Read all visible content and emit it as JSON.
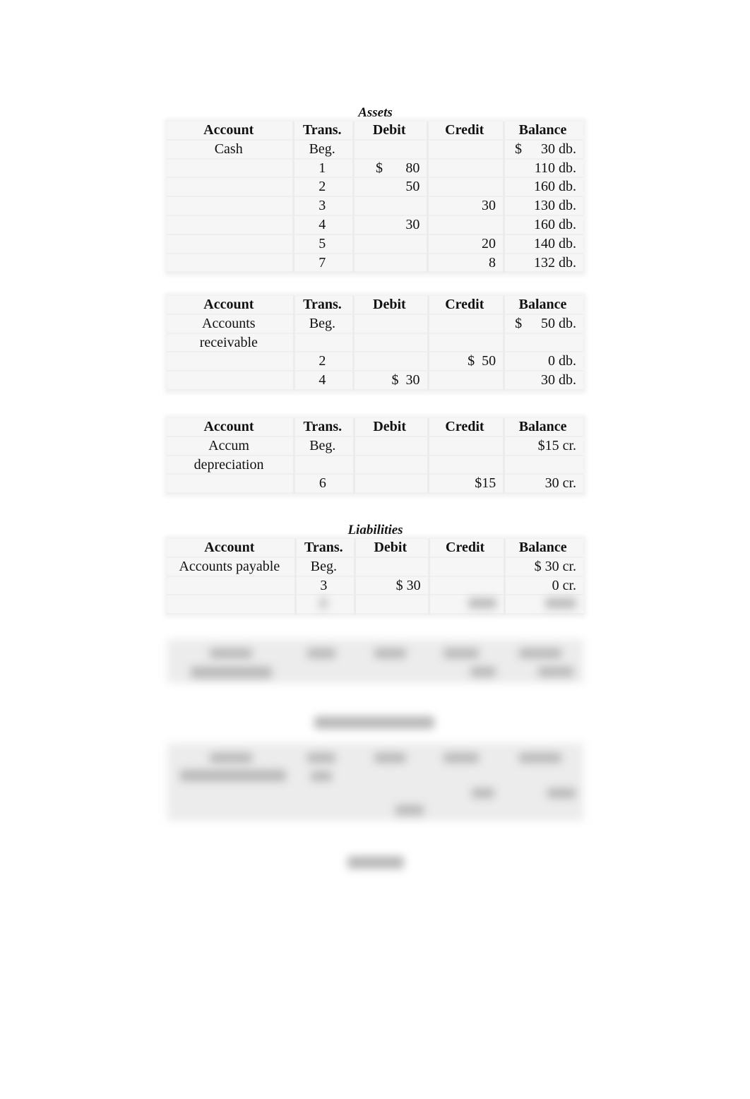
{
  "columns": [
    "Account",
    "Trans.",
    "Debit",
    "Credit",
    "Balance"
  ],
  "sections": {
    "assets": "Assets",
    "liabilities": "Liabilities"
  },
  "ledgers": {
    "cash": {
      "account": "Cash",
      "rows": [
        {
          "trans": "Beg.",
          "debit": "",
          "credit": "",
          "balance_sign": "$",
          "balance": "30 db."
        },
        {
          "trans": "1",
          "debit_sign": "$",
          "debit": "80",
          "credit": "",
          "balance": "110 db."
        },
        {
          "trans": "2",
          "debit": "50",
          "credit": "",
          "balance": "160 db."
        },
        {
          "trans": "3",
          "debit": "",
          "credit": "30",
          "balance": "130 db."
        },
        {
          "trans": "4",
          "debit": "30",
          "credit": "",
          "balance": "160 db."
        },
        {
          "trans": "5",
          "debit": "",
          "credit": "20",
          "balance": "140 db."
        },
        {
          "trans": "7",
          "debit": "",
          "credit": "8",
          "balance": "132 db."
        }
      ]
    },
    "accounts_receivable": {
      "account_line1": "Accounts",
      "account_line2": "receivable",
      "rows": [
        {
          "trans": "Beg.",
          "debit": "",
          "credit": "",
          "balance_sign": "$",
          "balance": "50 db."
        },
        {
          "trans": "2",
          "debit": "",
          "credit": "$  50",
          "balance": "0 db."
        },
        {
          "trans": "4",
          "debit": "$  30",
          "credit": "",
          "balance": "30 db."
        }
      ]
    },
    "accum_depreciation": {
      "account_line1": "Accum",
      "account_line2": "depreciation",
      "rows": [
        {
          "trans": "Beg.",
          "debit": "",
          "credit": "",
          "balance": "$15 cr."
        },
        {
          "trans": "6",
          "debit": "",
          "credit": "$15",
          "balance": "30 cr."
        }
      ]
    },
    "accounts_payable": {
      "account": "Accounts payable",
      "rows": [
        {
          "trans": "Beg.",
          "debit": "",
          "credit": "",
          "balance": "$ 30 cr."
        },
        {
          "trans": "3",
          "debit": "$ 30",
          "credit": "",
          "balance": "0 cr."
        }
      ]
    }
  }
}
